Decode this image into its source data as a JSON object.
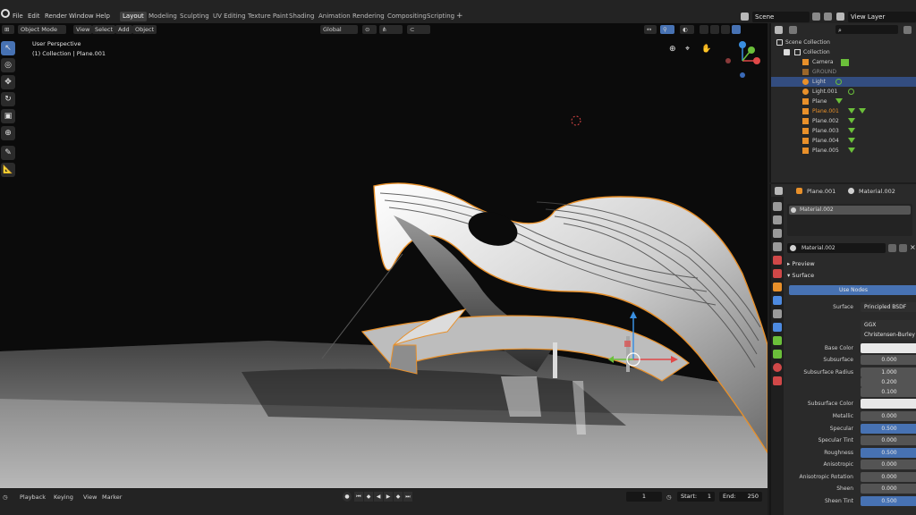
{
  "menu": [
    "File",
    "Edit",
    "Render",
    "Window",
    "Help"
  ],
  "workspaces": [
    "Layout",
    "Modeling",
    "Sculpting",
    "UV Editing",
    "Texture Paint",
    "Shading",
    "Animation",
    "Rendering",
    "Compositing",
    "Scripting"
  ],
  "active_workspace": "Layout",
  "scene_name": "Scene",
  "view_layer": "View Layer",
  "viewport": {
    "mode": "Object Mode",
    "menus": [
      "View",
      "Select",
      "Add",
      "Object"
    ],
    "transform": "Global",
    "perspective": "User Perspective",
    "collection_info": "(1) Collection | Plane.001"
  },
  "timeline": {
    "menus": [
      "Playback",
      "Keying",
      "View",
      "Marker"
    ],
    "current_frame": "1",
    "start_label": "Start",
    "start": "1",
    "end_label": "End",
    "end": "250"
  },
  "outliner": {
    "scene_collection": "Scene Collection",
    "collection": "Collection",
    "items": [
      "Camera",
      "GROUND",
      "Light",
      "Light.001",
      "Plane",
      "Plane.001",
      "Plane.002",
      "Plane.003",
      "Plane.004",
      "Plane.005"
    ],
    "selected": "Light"
  },
  "properties": {
    "object": "Plane.001",
    "material": "Material.002",
    "slot": "Material.002",
    "material_field": "Material.002",
    "preview_label": "Preview",
    "surface_section": "Surface",
    "use_nodes": "Use Nodes",
    "surface_label": "Surface",
    "surface_value": "Principled BSDF",
    "distribution": "GGX",
    "subsurface_method": "Christensen-Burley",
    "rows": [
      {
        "label": "Base Color",
        "value": "",
        "style": "white"
      },
      {
        "label": "Subsurface",
        "value": "0.000",
        "style": "gray"
      },
      {
        "label": "Subsurface Radius",
        "value": "1.000",
        "style": "gray"
      },
      {
        "label": "",
        "value": "0.200",
        "style": "gray"
      },
      {
        "label": "",
        "value": "0.100",
        "style": "gray"
      },
      {
        "label": "Subsurface Color",
        "value": "",
        "style": "white"
      },
      {
        "label": "Metallic",
        "value": "0.000",
        "style": "gray"
      },
      {
        "label": "Specular",
        "value": "0.500",
        "style": "blue"
      },
      {
        "label": "Specular Tint",
        "value": "0.000",
        "style": "gray"
      },
      {
        "label": "Roughness",
        "value": "0.500",
        "style": "blue"
      },
      {
        "label": "Anisotropic",
        "value": "0.000",
        "style": "gray"
      },
      {
        "label": "Anisotropic Rotation",
        "value": "0.000",
        "style": "gray"
      },
      {
        "label": "Sheen",
        "value": "0.000",
        "style": "gray"
      },
      {
        "label": "Sheen Tint",
        "value": "0.500",
        "style": "blue"
      }
    ]
  },
  "colors": {
    "accent": "#4772b3",
    "selection_outline": "#e8902a",
    "x_axis": "#e04848",
    "y_axis": "#6bbf3a",
    "z_axis": "#3a8fe0"
  }
}
